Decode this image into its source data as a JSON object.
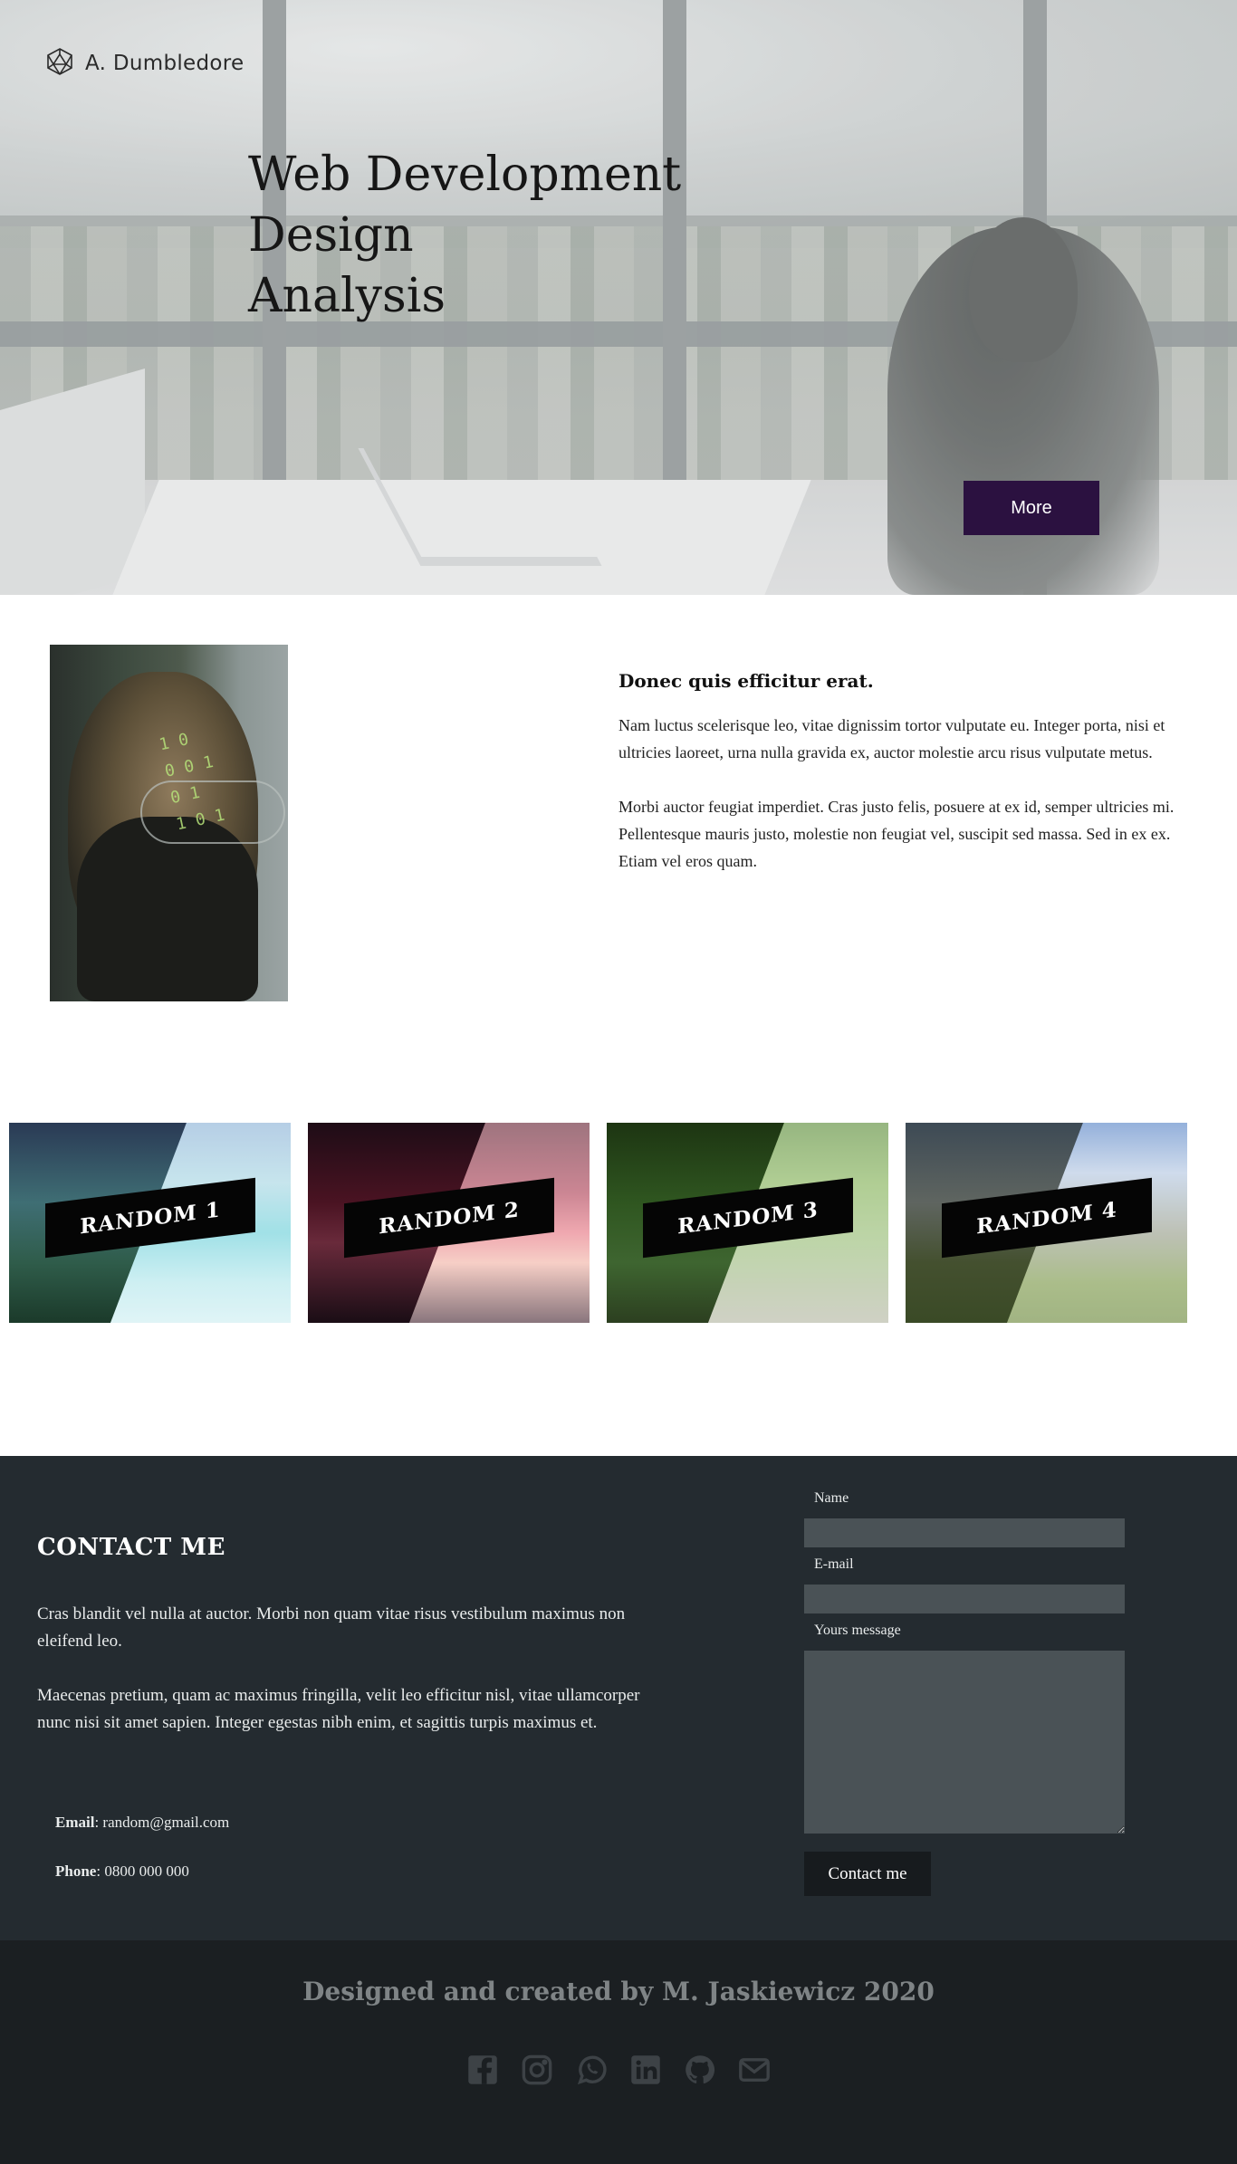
{
  "header": {
    "logo_text": "A. Dumbledore"
  },
  "hero": {
    "title_lines": [
      "Web Development",
      "Design",
      "Analysis"
    ],
    "more_button": "More"
  },
  "about": {
    "heading": "Donec quis efficitur erat.",
    "paragraph_1": "Nam luctus scelerisque leo, vitae dignissim tortor vulputate eu. Integer porta, nisi et ultricies laoreet, urna nulla gravida ex, auctor molestie arcu risus vulputate metus.",
    "paragraph_2": "Morbi auctor feugiat imperdiet. Cras justo felis, posuere at ex id, semper ultricies mi. Pellentesque mauris justo, molestie non feugiat vel, suscipit sed massa. Sed in ex ex. Etiam vel eros quam."
  },
  "cards": [
    {
      "label": "RANDOM 1"
    },
    {
      "label": "RANDOM 2"
    },
    {
      "label": "RANDOM 3"
    },
    {
      "label": "RANDOM 4"
    }
  ],
  "contact": {
    "title": "CONTACT ME",
    "paragraph_1": "Cras blandit vel nulla at auctor. Morbi non quam vitae risus vestibulum maximus non eleifend leo.",
    "paragraph_2": "Maecenas pretium, quam ac maximus fringilla, velit leo efficitur nisl, vitae ullamcorper nunc nisi sit amet sapien. Integer egestas nibh enim, et sagittis turpis maximus et.",
    "email_label": "Email",
    "email_value": ": random@gmail.com",
    "phone_label": "Phone",
    "phone_value": ": 0800 000 000",
    "form": {
      "name_label": "Name",
      "email_label": "E-mail",
      "message_label": "Yours message",
      "submit_label": "Contact me"
    }
  },
  "footer": {
    "credit": "Designed and created by M. Jaskiewicz 2020",
    "social_icons": [
      "facebook-icon",
      "instagram-icon",
      "whatsapp-icon",
      "linkedin-icon",
      "github-icon",
      "envelope-icon"
    ]
  },
  "colors": {
    "accent": "#2b1140",
    "contact_bg": "#242b30",
    "footer_bg": "#1b1f22",
    "input_bg": "#4a5256"
  }
}
